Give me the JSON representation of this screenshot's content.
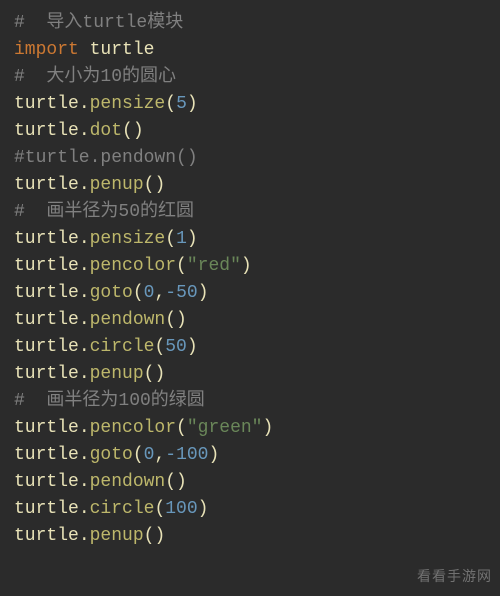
{
  "watermark": "看看手游网",
  "lines": [
    {
      "tokens": [
        {
          "cls": "tok-comment",
          "text": "#  导入turtle模块"
        }
      ]
    },
    {
      "tokens": [
        {
          "cls": "tok-keyword",
          "text": "import"
        },
        {
          "cls": "tok-punct",
          "text": " "
        },
        {
          "cls": "tok-module",
          "text": "turtle"
        }
      ]
    },
    {
      "tokens": [
        {
          "cls": "tok-comment",
          "text": "#  大小为10的圆心"
        }
      ]
    },
    {
      "tokens": [
        {
          "cls": "tok-ident",
          "text": "turtle"
        },
        {
          "cls": "tok-punct",
          "text": "."
        },
        {
          "cls": "tok-call",
          "text": "pensize"
        },
        {
          "cls": "tok-punct",
          "text": "("
        },
        {
          "cls": "tok-number",
          "text": "5"
        },
        {
          "cls": "tok-punct",
          "text": ")"
        }
      ]
    },
    {
      "tokens": [
        {
          "cls": "tok-ident",
          "text": "turtle"
        },
        {
          "cls": "tok-punct",
          "text": "."
        },
        {
          "cls": "tok-call",
          "text": "dot"
        },
        {
          "cls": "tok-punct",
          "text": "()"
        }
      ]
    },
    {
      "tokens": [
        {
          "cls": "tok-comment",
          "text": "#turtle.pendown()"
        }
      ]
    },
    {
      "tokens": [
        {
          "cls": "tok-ident",
          "text": "turtle"
        },
        {
          "cls": "tok-punct",
          "text": "."
        },
        {
          "cls": "tok-call",
          "text": "penup"
        },
        {
          "cls": "tok-punct",
          "text": "()"
        }
      ]
    },
    {
      "tokens": [
        {
          "cls": "tok-comment",
          "text": "#  画半径为50的红圆"
        }
      ]
    },
    {
      "tokens": [
        {
          "cls": "tok-ident",
          "text": "turtle"
        },
        {
          "cls": "tok-punct",
          "text": "."
        },
        {
          "cls": "tok-call",
          "text": "pensize"
        },
        {
          "cls": "tok-punct",
          "text": "("
        },
        {
          "cls": "tok-number",
          "text": "1"
        },
        {
          "cls": "tok-punct",
          "text": ")"
        }
      ]
    },
    {
      "tokens": [
        {
          "cls": "tok-ident",
          "text": "turtle"
        },
        {
          "cls": "tok-punct",
          "text": "."
        },
        {
          "cls": "tok-call",
          "text": "pencolor"
        },
        {
          "cls": "tok-punct",
          "text": "("
        },
        {
          "cls": "tok-string",
          "text": "\"red\""
        },
        {
          "cls": "tok-punct",
          "text": ")"
        }
      ]
    },
    {
      "tokens": [
        {
          "cls": "tok-ident",
          "text": "turtle"
        },
        {
          "cls": "tok-punct",
          "text": "."
        },
        {
          "cls": "tok-call",
          "text": "goto"
        },
        {
          "cls": "tok-punct",
          "text": "("
        },
        {
          "cls": "tok-number",
          "text": "0"
        },
        {
          "cls": "tok-punct",
          "text": ","
        },
        {
          "cls": "tok-number",
          "text": "-50"
        },
        {
          "cls": "tok-punct",
          "text": ")"
        }
      ]
    },
    {
      "tokens": [
        {
          "cls": "tok-ident",
          "text": "turtle"
        },
        {
          "cls": "tok-punct",
          "text": "."
        },
        {
          "cls": "tok-call",
          "text": "pendown"
        },
        {
          "cls": "tok-punct",
          "text": "()"
        }
      ]
    },
    {
      "tokens": [
        {
          "cls": "tok-ident",
          "text": "turtle"
        },
        {
          "cls": "tok-punct",
          "text": "."
        },
        {
          "cls": "tok-call",
          "text": "circle"
        },
        {
          "cls": "tok-punct",
          "text": "("
        },
        {
          "cls": "tok-number",
          "text": "50"
        },
        {
          "cls": "tok-punct",
          "text": ")"
        }
      ]
    },
    {
      "tokens": [
        {
          "cls": "tok-ident",
          "text": "turtle"
        },
        {
          "cls": "tok-punct",
          "text": "."
        },
        {
          "cls": "tok-call",
          "text": "penup"
        },
        {
          "cls": "tok-punct",
          "text": "()"
        }
      ]
    },
    {
      "tokens": [
        {
          "cls": "tok-comment",
          "text": "#  画半径为100的绿圆"
        }
      ]
    },
    {
      "tokens": [
        {
          "cls": "tok-ident",
          "text": "turtle"
        },
        {
          "cls": "tok-punct",
          "text": "."
        },
        {
          "cls": "tok-call",
          "text": "pencolor"
        },
        {
          "cls": "tok-punct",
          "text": "("
        },
        {
          "cls": "tok-string",
          "text": "\"green\""
        },
        {
          "cls": "tok-punct",
          "text": ")"
        }
      ]
    },
    {
      "tokens": [
        {
          "cls": "tok-ident",
          "text": "turtle"
        },
        {
          "cls": "tok-punct",
          "text": "."
        },
        {
          "cls": "tok-call",
          "text": "goto"
        },
        {
          "cls": "tok-punct",
          "text": "("
        },
        {
          "cls": "tok-number",
          "text": "0"
        },
        {
          "cls": "tok-punct",
          "text": ","
        },
        {
          "cls": "tok-number",
          "text": "-100"
        },
        {
          "cls": "tok-punct",
          "text": ")"
        }
      ]
    },
    {
      "tokens": [
        {
          "cls": "tok-ident",
          "text": "turtle"
        },
        {
          "cls": "tok-punct",
          "text": "."
        },
        {
          "cls": "tok-call",
          "text": "pendown"
        },
        {
          "cls": "tok-punct",
          "text": "()"
        }
      ]
    },
    {
      "tokens": [
        {
          "cls": "tok-ident",
          "text": "turtle"
        },
        {
          "cls": "tok-punct",
          "text": "."
        },
        {
          "cls": "tok-call",
          "text": "circle"
        },
        {
          "cls": "tok-punct",
          "text": "("
        },
        {
          "cls": "tok-number",
          "text": "100"
        },
        {
          "cls": "tok-punct",
          "text": ")"
        }
      ]
    },
    {
      "tokens": [
        {
          "cls": "tok-ident",
          "text": "turtle"
        },
        {
          "cls": "tok-punct",
          "text": "."
        },
        {
          "cls": "tok-call",
          "text": "penup"
        },
        {
          "cls": "tok-punct",
          "text": "()"
        }
      ]
    }
  ]
}
